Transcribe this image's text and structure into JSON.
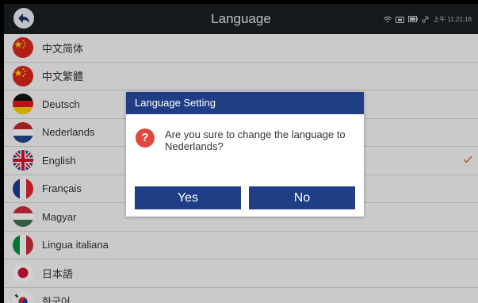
{
  "header": {
    "title": "Language",
    "time": "上午 11:21:16"
  },
  "languages": [
    {
      "label": "中文简体",
      "flag": "china-flag-icon",
      "selected": false
    },
    {
      "label": "中文繁體",
      "flag": "china-flag-icon",
      "selected": false
    },
    {
      "label": "Deutsch",
      "flag": "germany-flag-icon",
      "selected": false
    },
    {
      "label": "Nederlands",
      "flag": "netherlands-flag-icon",
      "selected": false
    },
    {
      "label": "English",
      "flag": "uk-flag-icon",
      "selected": true
    },
    {
      "label": "Français",
      "flag": "france-flag-icon",
      "selected": false
    },
    {
      "label": "Magyar",
      "flag": "hungary-flag-icon",
      "selected": false
    },
    {
      "label": "Lingua italiana",
      "flag": "italy-flag-icon",
      "selected": false
    },
    {
      "label": "日本語",
      "flag": "japan-flag-icon",
      "selected": false
    },
    {
      "label": "한국어",
      "flag": "korea-flag-icon",
      "selected": false
    }
  ],
  "dialog": {
    "title": "Language Setting",
    "message": "Are you sure to change the language to Nederlands?",
    "yes_label": "Yes",
    "no_label": "No"
  },
  "colors": {
    "dialog_accent": "#203e86",
    "check": "#e05a4f",
    "question_icon": "#e0473f"
  }
}
